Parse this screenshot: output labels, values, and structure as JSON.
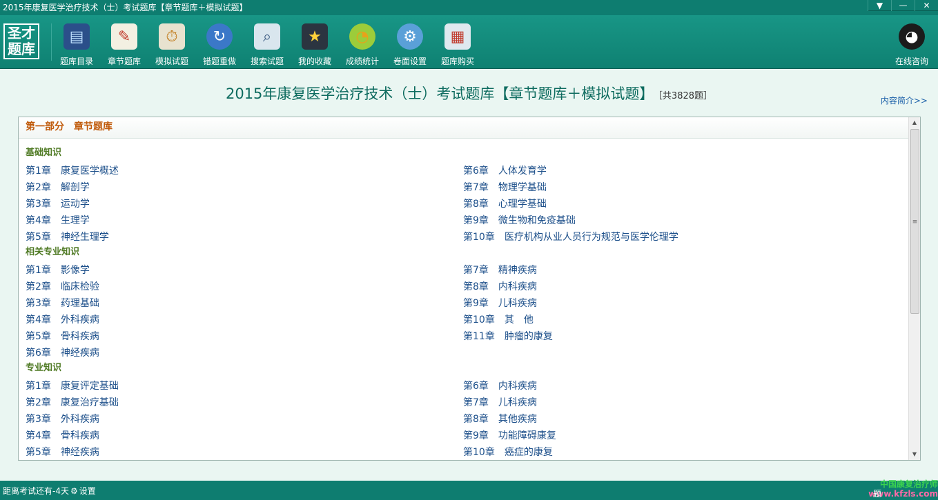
{
  "window": {
    "title": "2015年康复医学治疗技术（士）考试题库【章节题库＋模拟试题】",
    "controls": [
      "▼",
      "—",
      "✕"
    ]
  },
  "toolbar": {
    "logo": [
      "圣才",
      "题库"
    ],
    "items": [
      {
        "label": "题库目录",
        "icon": "monitor-icon"
      },
      {
        "label": "章节题库",
        "icon": "notepad-icon"
      },
      {
        "label": "模拟试题",
        "icon": "clipboard-clock-icon"
      },
      {
        "label": "错题重做",
        "icon": "refresh-arrow-icon"
      },
      {
        "label": "搜索试题",
        "icon": "magnifier-icon"
      },
      {
        "label": "我的收藏",
        "icon": "book-star-icon"
      },
      {
        "label": "成绩统计",
        "icon": "pie-chart-icon"
      },
      {
        "label": "卷面设置",
        "icon": "settings-gear-icon"
      },
      {
        "label": "题库购买",
        "icon": "cart-card-icon"
      }
    ],
    "support": {
      "label": "在线咨询",
      "icon": "qq-penguin-icon"
    }
  },
  "header": {
    "title": "2015年康复医学治疗技术（士）考试题库【章节题库＋模拟试题】",
    "count": "［共3828题］",
    "intro_link": "内容简介>>"
  },
  "section": {
    "part": "第一部分",
    "name": "章节题库"
  },
  "groups": [
    {
      "title": "基础知识",
      "left": [
        {
          "no": "第1章",
          "name": "康复医学概述"
        },
        {
          "no": "第2章",
          "name": "解剖学"
        },
        {
          "no": "第3章",
          "name": "运动学"
        },
        {
          "no": "第4章",
          "name": "生理学"
        },
        {
          "no": "第5章",
          "name": "神经生理学"
        }
      ],
      "right": [
        {
          "no": "第6章",
          "name": "人体发育学"
        },
        {
          "no": "第7章",
          "name": "物理学基础"
        },
        {
          "no": "第8章",
          "name": "心理学基础"
        },
        {
          "no": "第9章",
          "name": "微生物和免疫基础"
        },
        {
          "no": "第10章",
          "name": "医疗机构从业人员行为规范与医学伦理学"
        }
      ]
    },
    {
      "title": "相关专业知识",
      "left": [
        {
          "no": "第1章",
          "name": "影像学"
        },
        {
          "no": "第2章",
          "name": "临床检验"
        },
        {
          "no": "第3章",
          "name": "药理基础"
        },
        {
          "no": "第4章",
          "name": "外科疾病"
        },
        {
          "no": "第5章",
          "name": "骨科疾病"
        },
        {
          "no": "第6章",
          "name": "神经疾病"
        }
      ],
      "right": [
        {
          "no": "第7章",
          "name": "精神疾病"
        },
        {
          "no": "第8章",
          "name": "内科疾病"
        },
        {
          "no": "第9章",
          "name": "儿科疾病"
        },
        {
          "no": "第10章",
          "name": "其　他"
        },
        {
          "no": "第11章",
          "name": "肿瘤的康复"
        }
      ]
    },
    {
      "title": "专业知识",
      "left": [
        {
          "no": "第1章",
          "name": "康复评定基础"
        },
        {
          "no": "第2章",
          "name": "康复治疗基础"
        },
        {
          "no": "第3章",
          "name": "外科疾病"
        },
        {
          "no": "第4章",
          "name": "骨科疾病"
        },
        {
          "no": "第5章",
          "name": "神经疾病"
        }
      ],
      "right": [
        {
          "no": "第6章",
          "name": "内科疾病"
        },
        {
          "no": "第7章",
          "name": "儿科疾病"
        },
        {
          "no": "第8章",
          "name": "其他疾病"
        },
        {
          "no": "第9章",
          "name": "功能障碍康复"
        },
        {
          "no": "第10章",
          "name": "癌症的康复"
        }
      ]
    }
  ],
  "scrollbar": {
    "up": "▲",
    "down": "▼",
    "grip": "≡"
  },
  "status": {
    "countdown": "距离考试还有-4天",
    "settings": "设置",
    "right_stub": "题",
    "brand": "中国康复治疗师",
    "site": "www.kfzls.com"
  },
  "colors": {
    "titlebar": "#0e7d70",
    "toolbar": "#138b7c",
    "section_title": "#c05a0a",
    "subhead": "#4f7a24",
    "chapter_link": "#1c4f8a"
  }
}
